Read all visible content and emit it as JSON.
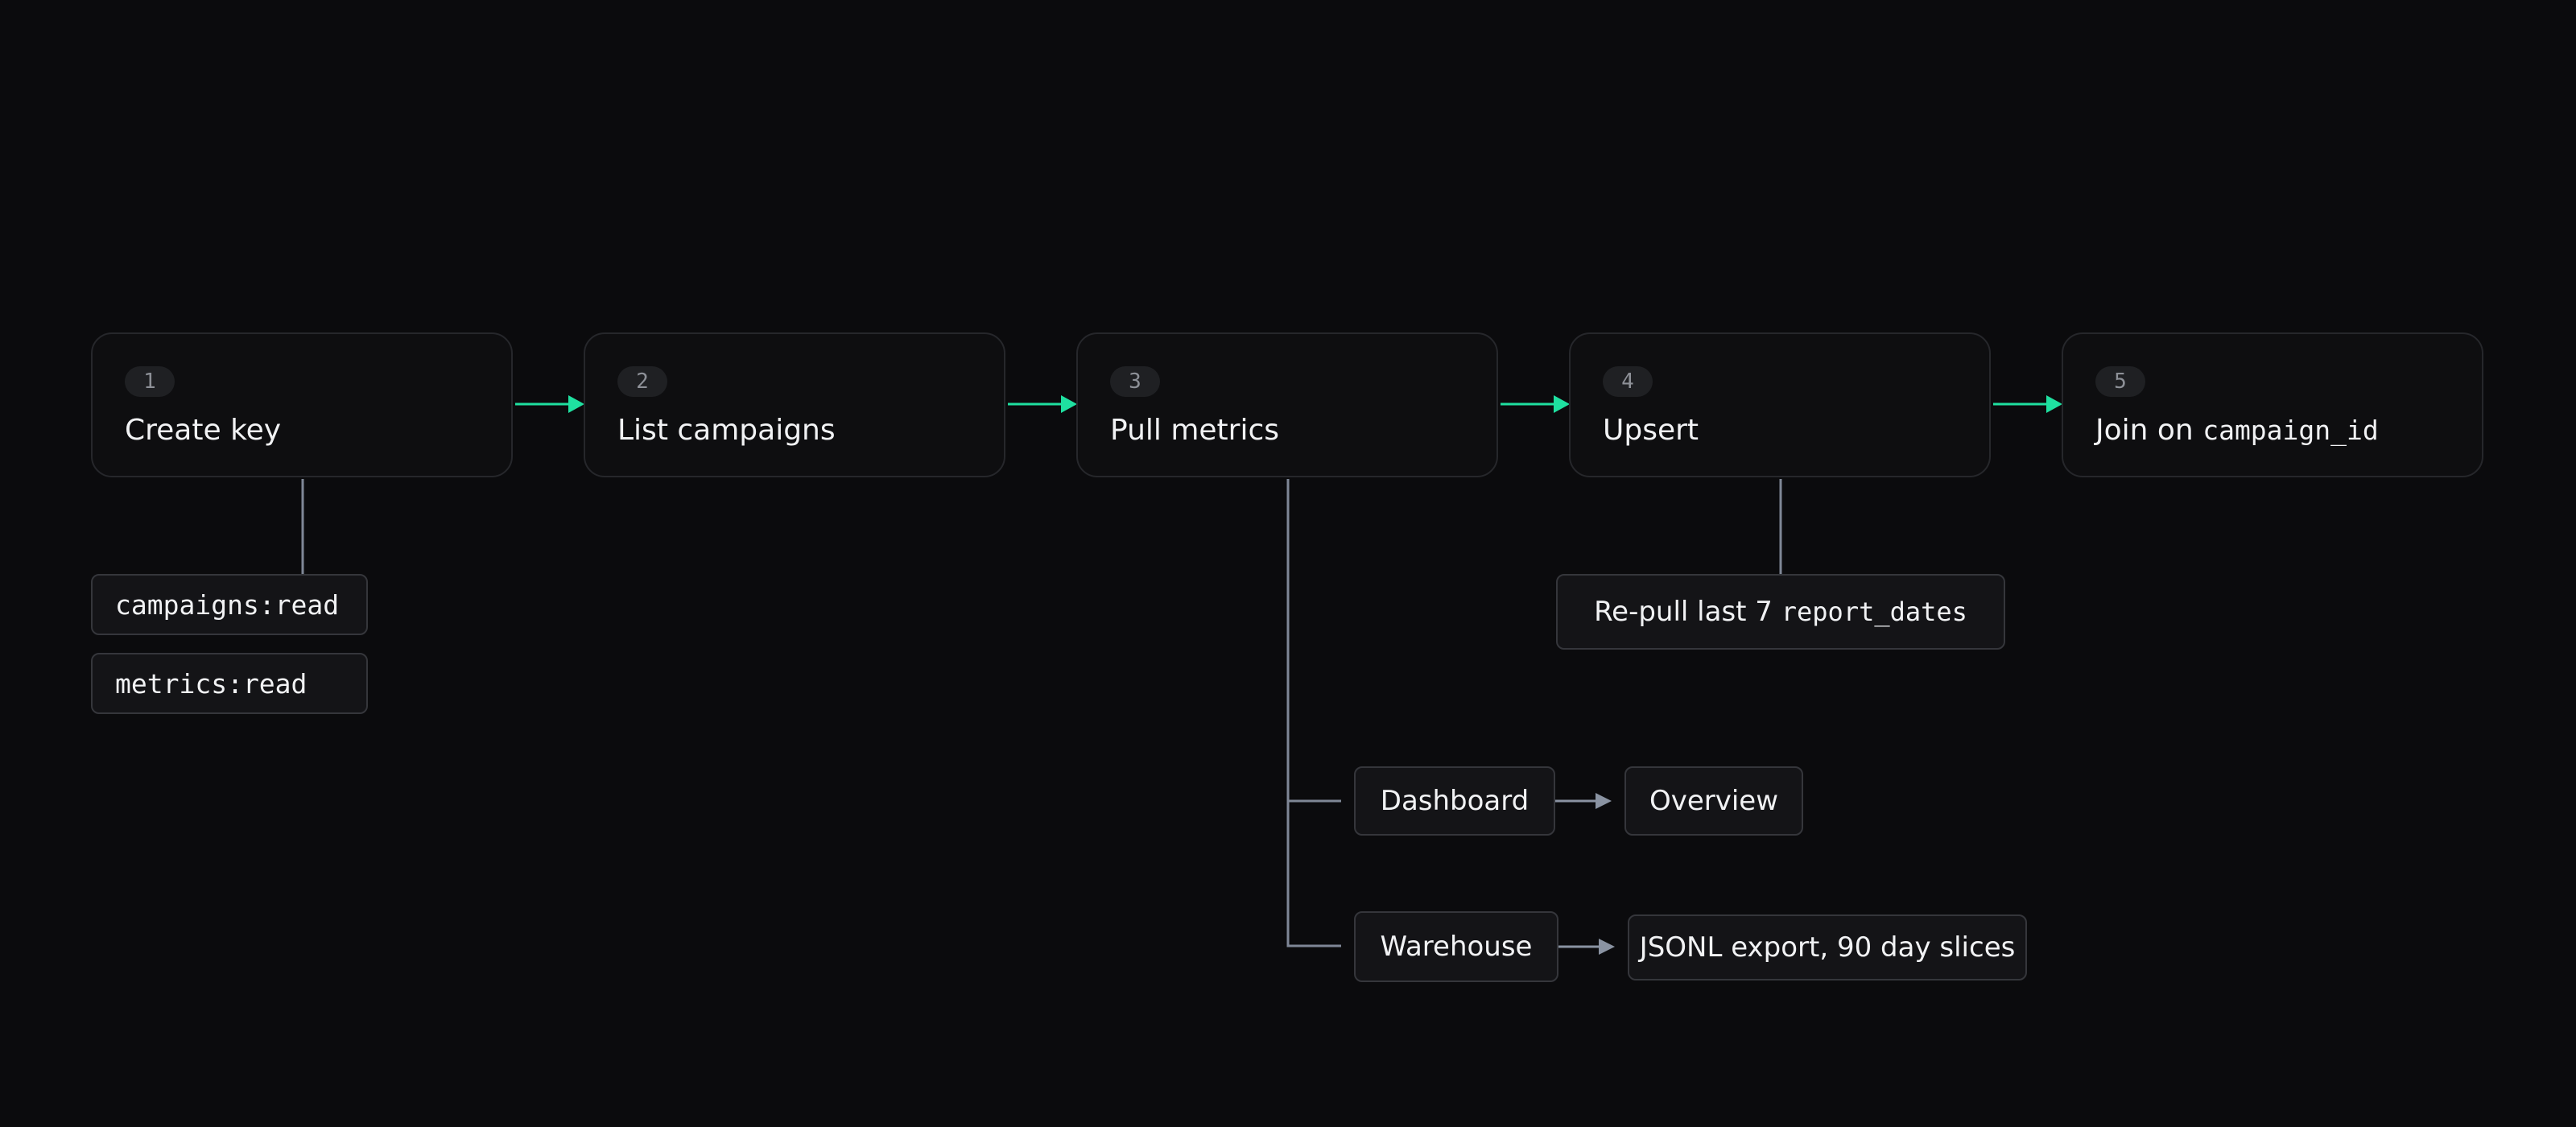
{
  "steps": [
    {
      "num": "1",
      "title": "Create key"
    },
    {
      "num": "2",
      "title": "List campaigns"
    },
    {
      "num": "3",
      "title": "Pull metrics"
    },
    {
      "num": "4",
      "title": "Upsert"
    },
    {
      "num": "5",
      "title_prefix": "Join on ",
      "title_code": "campaign_id"
    }
  ],
  "scopes": [
    "campaigns:read",
    "metrics:read"
  ],
  "upsert_note": {
    "prefix": "Re-pull last 7 ",
    "code": "report_dates"
  },
  "outputs": [
    {
      "label": "Dashboard",
      "target": "Overview"
    },
    {
      "label": "Warehouse",
      "target": "JSONL export, 90 day slices"
    }
  ],
  "colors": {
    "background": "#0b0b0d",
    "main_flow_arrow": "#1fe0a0",
    "branch_line": "#7f8796",
    "box_border": "#26272b"
  }
}
